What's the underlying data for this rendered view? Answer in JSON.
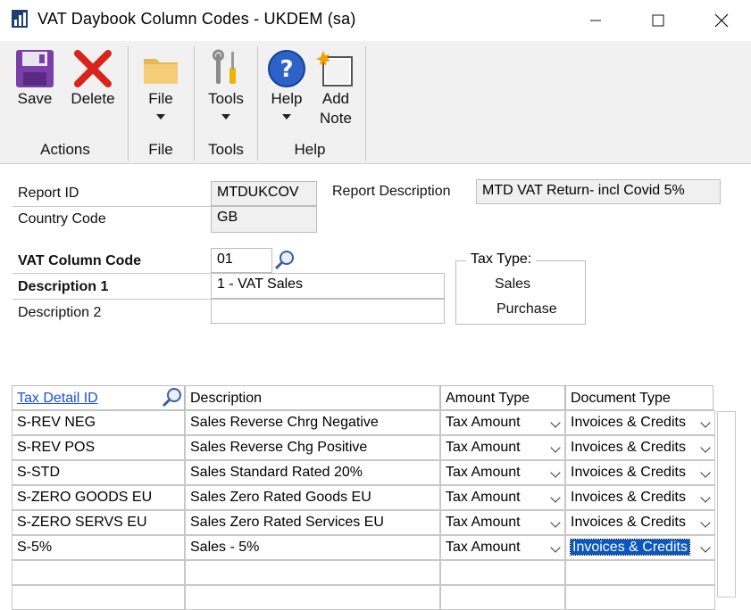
{
  "window": {
    "title": "VAT Daybook Column Codes  -  UKDEM (sa)",
    "controls": {
      "minimize": "–",
      "maximize": "□",
      "close": "✕"
    }
  },
  "ribbon": {
    "groups": [
      {
        "label": "Actions",
        "buttons": [
          {
            "label": "Save",
            "icon": "save-icon"
          },
          {
            "label": "Delete",
            "icon": "delete-icon"
          }
        ]
      },
      {
        "label": "File",
        "buttons": [
          {
            "label": "File",
            "icon": "folder-icon"
          }
        ]
      },
      {
        "label": "Tools",
        "buttons": [
          {
            "label": "Tools",
            "icon": "tools-icon"
          }
        ]
      },
      {
        "label": "Help",
        "buttons": [
          {
            "label": "Help",
            "icon": "help-icon"
          },
          {
            "label": "Add",
            "label2": "Note",
            "icon": "note-icon"
          }
        ]
      }
    ]
  },
  "header": {
    "report_id_label": "Report ID",
    "report_id": "MTDUKCOV",
    "country_code_label": "Country Code",
    "country_code": "GB",
    "report_desc_label": "Report Description",
    "report_desc": "MTD VAT Return- incl Covid 5%"
  },
  "code": {
    "vat_column_code_label": "VAT Column Code",
    "vat_column_code": "01",
    "description1_label": "Description 1",
    "description1": "1 - VAT Sales",
    "description2_label": "Description 2",
    "description2": ""
  },
  "tax_type": {
    "title": "Tax Type:",
    "options": [
      "Sales",
      "Purchase"
    ]
  },
  "grid": {
    "columns": [
      "Tax Detail ID",
      "Description",
      "Amount Type",
      "Document Type"
    ],
    "rows": [
      {
        "id": "S-REV NEG",
        "desc": "Sales Reverse Chrg Negative",
        "amount": "Tax Amount",
        "doc": "Invoices & Credits"
      },
      {
        "id": "S-REV POS",
        "desc": "Sales Reverse Chg Positive",
        "amount": "Tax Amount",
        "doc": "Invoices & Credits"
      },
      {
        "id": "S-STD",
        "desc": "Sales Standard Rated 20%",
        "amount": "Tax Amount",
        "doc": "Invoices & Credits"
      },
      {
        "id": "S-ZERO GOODS EU",
        "desc": "Sales Zero Rated Goods EU",
        "amount": "Tax Amount",
        "doc": "Invoices & Credits"
      },
      {
        "id": "S-ZERO SERVS EU",
        "desc": "Sales Zero Rated Services EU",
        "amount": "Tax Amount",
        "doc": "Invoices & Credits"
      },
      {
        "id": "S-5%",
        "desc": "Sales - 5%",
        "amount": "Tax Amount",
        "doc": "Invoices & Credits"
      }
    ]
  },
  "colors": {
    "accent": "#0a57c2",
    "link": "#1a4fd6",
    "ribbon_bg": "#f1f1f1"
  }
}
